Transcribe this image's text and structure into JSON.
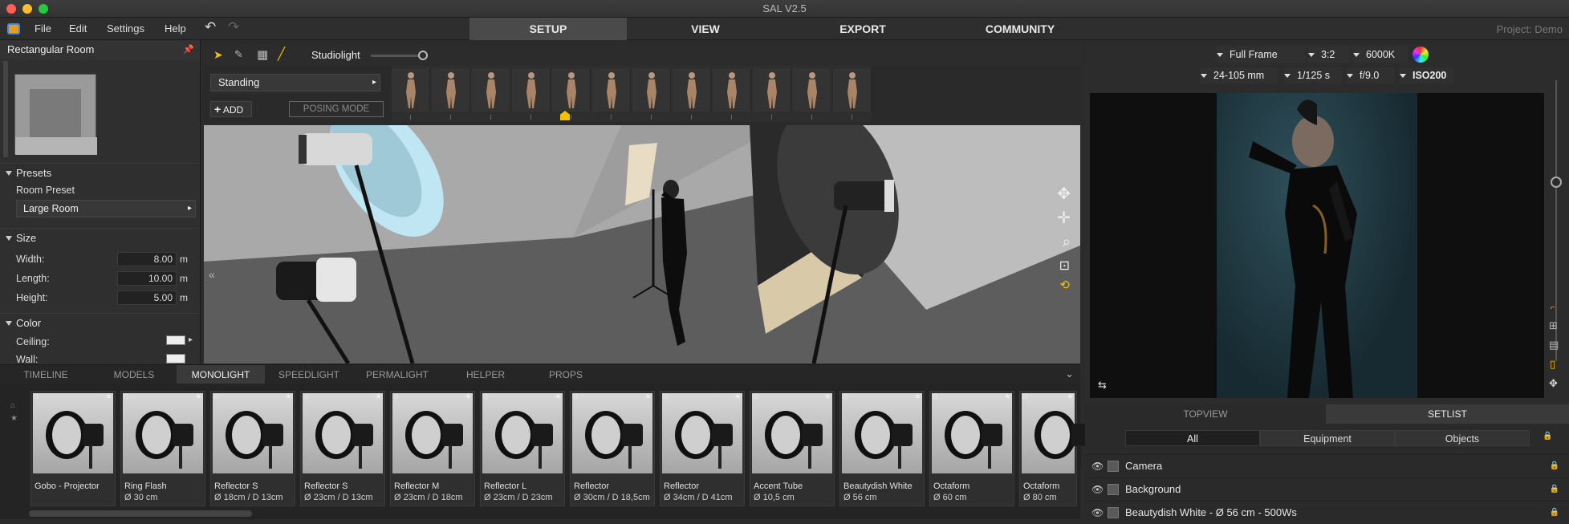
{
  "window": {
    "title": "SAL V2.5",
    "project": "Project: Demo"
  },
  "menu": {
    "file": "File",
    "edit": "Edit",
    "settings": "Settings",
    "help": "Help"
  },
  "main_tabs": {
    "setup": "SETUP",
    "view": "VIEW",
    "export": "EXPORT",
    "community": "COMMUNITY"
  },
  "left_panel": {
    "title": "Rectangular Room",
    "presets": {
      "header": "Presets",
      "room_preset_label": "Room Preset",
      "room_preset_value": "Large Room"
    },
    "size": {
      "header": "Size",
      "width_label": "Width:",
      "width": "8.00",
      "length_label": "Length:",
      "length": "10.00",
      "height_label": "Height:",
      "height": "5.00",
      "unit": "m"
    },
    "color": {
      "header": "Color",
      "ceiling_label": "Ceiling:",
      "wall_label": "Wall:"
    }
  },
  "toolbar": {
    "studiolight_label": "Studiolight",
    "studiolight_level": 0.95
  },
  "pose": {
    "category": "Standing",
    "add_label": "ADD",
    "posing_mode_label": "POSING MODE"
  },
  "bottom_tabs": [
    "TIMELINE",
    "MODELS",
    "MONOLIGHT",
    "SPEEDLIGHT",
    "PERMALIGHT",
    "HELPER",
    "PROPS"
  ],
  "active_bottom_tab": "MONOLIGHT",
  "cards": [
    {
      "name": "Gobo - Projector",
      "sub": ""
    },
    {
      "name": "Ring Flash",
      "sub": "Ø 30 cm"
    },
    {
      "name": "Reflector S",
      "sub": "Ø 18cm / D 13cm"
    },
    {
      "name": "Reflector S",
      "sub": "Ø 23cm / D 13cm"
    },
    {
      "name": "Reflector M",
      "sub": "Ø 23cm / D 18cm"
    },
    {
      "name": "Reflector L",
      "sub": "Ø 23cm / D 23cm"
    },
    {
      "name": "Reflector",
      "sub": "Ø 30cm / D 18,5cm"
    },
    {
      "name": "Reflector",
      "sub": "Ø 34cm / D 41cm"
    },
    {
      "name": "Accent Tube",
      "sub": "Ø 10,5 cm"
    },
    {
      "name": "Beautydish White",
      "sub": "Ø 56 cm"
    },
    {
      "name": "Octaform",
      "sub": "Ø 60 cm"
    },
    {
      "name": "Octaform",
      "sub": "Ø 80 cm"
    }
  ],
  "camera": {
    "frame": "Full Frame",
    "ratio": "3:2",
    "kelvin": "6000K",
    "lens": "24-105 mm",
    "shutter": "1/125 s",
    "aperture": "f/9.0",
    "iso": "ISO200"
  },
  "right_tabs": {
    "topview": "TOPVIEW",
    "setlist": "SETLIST"
  },
  "filters": {
    "all": "All",
    "equipment": "Equipment",
    "objects": "Objects"
  },
  "setlist_items": [
    "Camera",
    "Background",
    "Beautydish White - Ø 56 cm - 500Ws"
  ],
  "colors": {
    "accent": "#f2c200",
    "active_tab": "#4a4a4a",
    "panel": "#2f2f2f"
  }
}
